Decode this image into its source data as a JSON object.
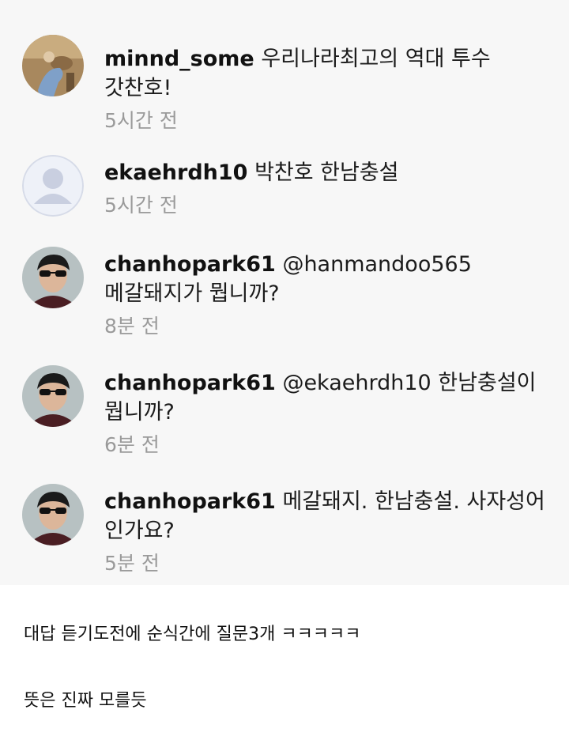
{
  "comments": [
    {
      "username": "minnd_some",
      "text_line1": "우리나라최고의 역대 투수",
      "text_line2": "갓찬호!",
      "time": "5시간 전",
      "avatar": "photo-person-avatar"
    },
    {
      "username": "ekaehrdh10",
      "text_line1": "박찬호 한남충설",
      "text_line2": "",
      "time": "5시간 전",
      "avatar": "default-user-avatar"
    },
    {
      "username": "chanhopark61",
      "text_line1": "@hanmandoo565",
      "text_line2": "메갈돼지가 뭡니까?",
      "time": "8분 전",
      "avatar": "sunglasses-man-avatar"
    },
    {
      "username": "chanhopark61",
      "text_line1": "@ekaehrdh10 한남충설이",
      "text_line2": "뭡니까?",
      "time": "6분 전",
      "avatar": "sunglasses-man-avatar"
    },
    {
      "username": "chanhopark61",
      "text_line1": "메갈돼지. 한남충설. 사자성어",
      "text_line2": "인가요?",
      "time": "5분 전",
      "avatar": "sunglasses-man-avatar"
    }
  ],
  "caption": {
    "line1": "대답 듣기도전에 순식간에 질문3개 ㅋㅋㅋㅋㅋ",
    "line2": "뜻은 진짜 모를듯"
  }
}
